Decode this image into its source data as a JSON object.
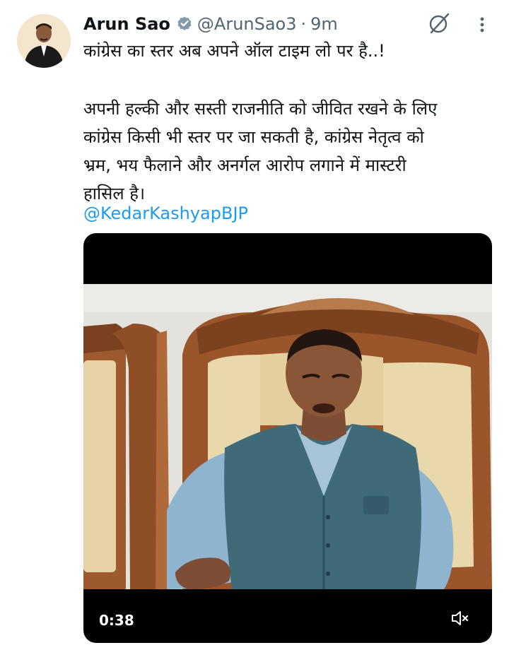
{
  "tweet": {
    "author_name": "Arun Sao",
    "handle": "@ArunSao3",
    "separator": "·",
    "time": "9m",
    "text_line1": "कांग्रेस का स्तर अब अपने ऑल टाइम लो पर है..!",
    "paragraph_lines": [
      "अपनी हल्की और सस्ती राजनीति को जीवित रखने के लिए",
      "कांग्रेस किसी भी स्तर पर जा सकती है, कांग्रेस नेतृत्व को",
      "भ्रम, भय फैलाने और अनर्गल आरोप लगाने में मास्टरी",
      "हासिल है।"
    ],
    "mention": "@KedarKashyapBJP"
  },
  "media": {
    "duration": "0:38",
    "muted": true
  },
  "icons": {
    "verified": "verified-badge-icon",
    "grok": "grok-icon",
    "more": "more-vertical-icon",
    "mute": "volume-muted-icon"
  },
  "colors": {
    "link": "#1d9bf0",
    "secondary_text": "#536471",
    "primary_text": "#0f1419"
  }
}
